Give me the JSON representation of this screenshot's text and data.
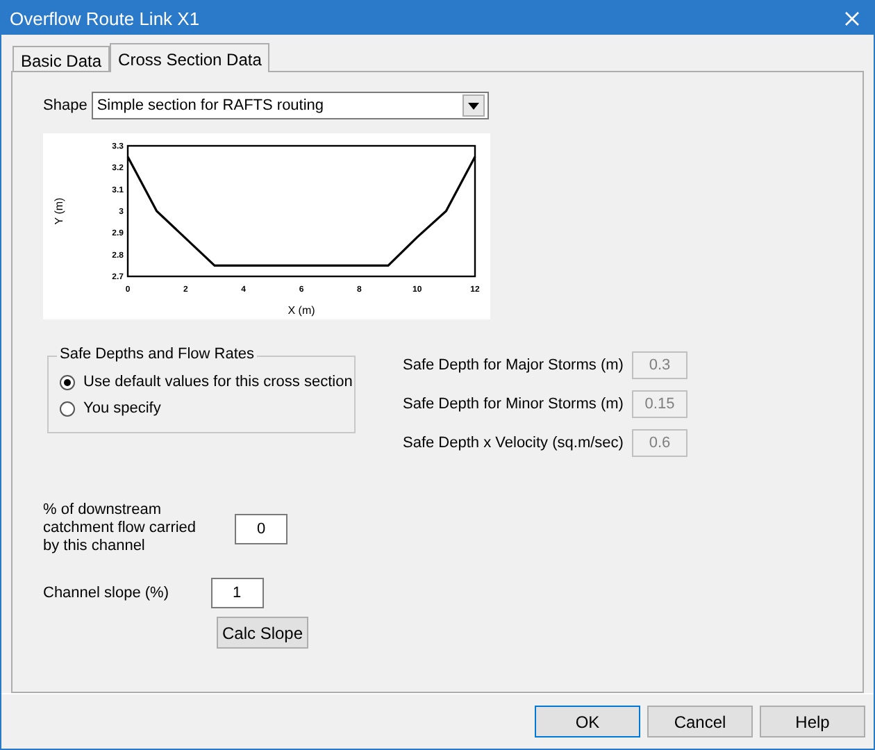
{
  "window": {
    "title": "Overflow Route Link X1"
  },
  "tabs": [
    {
      "label": "Basic Data",
      "selected": false
    },
    {
      "label": "Cross Section Data",
      "selected": true
    }
  ],
  "shape": {
    "label": "Shape",
    "value": "Simple section for RAFTS routing"
  },
  "chart_data": {
    "type": "line",
    "xlabel": "X (m)",
    "ylabel": "Y (m)",
    "x": [
      0,
      1,
      3,
      9,
      10,
      11,
      12
    ],
    "series": [
      {
        "color": "#000000",
        "values": [
          3.25,
          3.0,
          2.75,
          2.75,
          2.88,
          3.0,
          3.25
        ]
      }
    ],
    "xlim": [
      0,
      12
    ],
    "ylim": [
      2.7,
      3.3
    ],
    "xticks": [
      0,
      2,
      4,
      6,
      8,
      10,
      12
    ],
    "yticks": [
      {
        "value": 2.7,
        "label": "2.7"
      },
      {
        "value": 2.8,
        "label": "2.8"
      },
      {
        "value": 2.9,
        "label": "2.9"
      },
      {
        "value": 3,
        "label": "3"
      },
      {
        "value": 3.1,
        "label": "3.1"
      },
      {
        "value": 3.2,
        "label": "3.2"
      },
      {
        "value": 3.3,
        "label": "3.3"
      }
    ]
  },
  "safe_group": {
    "title": "Safe Depths and Flow Rates",
    "options": [
      {
        "label": "Use default values for this cross section",
        "selected": true
      },
      {
        "label": "You specify",
        "selected": false
      }
    ]
  },
  "safe_fields": [
    {
      "label": "Safe Depth for Major Storms (m)",
      "value": "0.3",
      "disabled": true
    },
    {
      "label": "Safe Depth for Minor Storms (m)",
      "value": "0.15",
      "disabled": true
    },
    {
      "label": "Safe Depth x Velocity (sq.m/sec)",
      "value": "0.6",
      "disabled": true
    }
  ],
  "flow_field": {
    "label": "% of downstream catchment flow carried by this channel",
    "value": "0"
  },
  "slope_field": {
    "label": "Channel slope (%)",
    "value": "1"
  },
  "calc_button": "Calc Slope",
  "buttons": [
    "OK",
    "Cancel",
    "Help"
  ]
}
